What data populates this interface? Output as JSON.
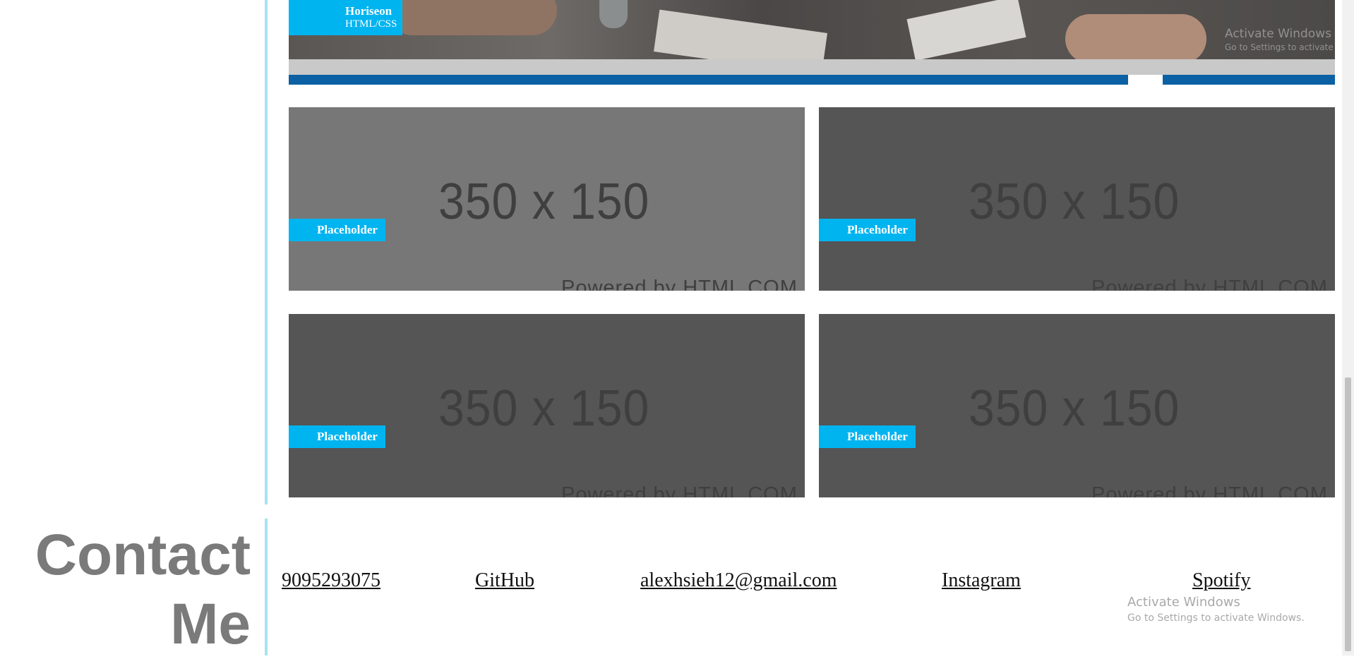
{
  "featured_project": {
    "name": "Horiseon",
    "subtitle": "HTML/CSS"
  },
  "projects": [
    {
      "image_text": "350 x 150",
      "image_caption": "Powered by HTML.COM",
      "label": "Placeholder"
    },
    {
      "image_text": "350 x 150",
      "image_caption": "Powered by HTML.COM",
      "label": "Placeholder"
    },
    {
      "image_text": "350 x 150",
      "image_caption": "Powered by HTML.COM",
      "label": "Placeholder"
    },
    {
      "image_text": "350 x 150",
      "image_caption": "Powered by HTML.COM",
      "label": "Placeholder"
    }
  ],
  "contact": {
    "title_line1": "Contact",
    "title_line2": "Me",
    "phone": "9095293075",
    "github": "GitHub",
    "email": "alexhsieh12@gmail.com",
    "instagram": "Instagram",
    "spotify": "Spotify"
  },
  "watermark": {
    "title": "Activate Windows",
    "top_sub": "Go to Settings to activate",
    "bottom_sub": "Go to Settings to activate Windows."
  },
  "colors": {
    "badge": "#00b4f0",
    "divider": "#a6e3ef",
    "hero_bar": "#0b61a4",
    "contact_title": "#7a7a7a"
  }
}
